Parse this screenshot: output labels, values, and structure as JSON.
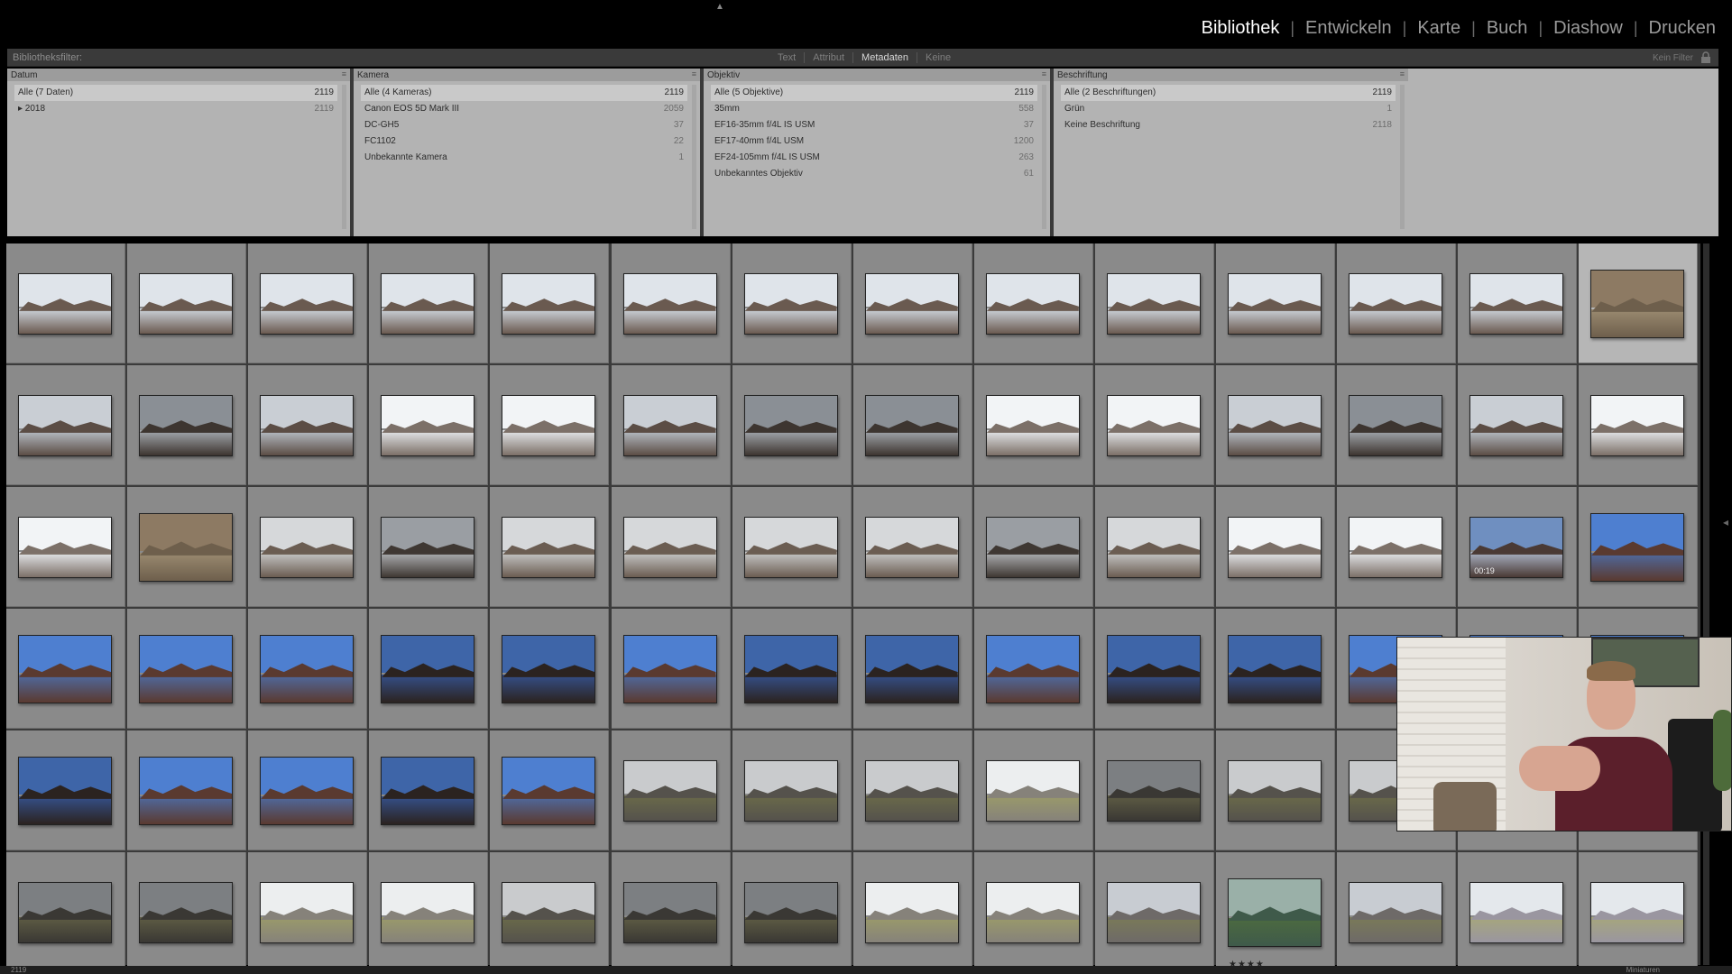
{
  "modules": [
    "Bibliothek",
    "Entwickeln",
    "Karte",
    "Buch",
    "Diashow",
    "Drucken"
  ],
  "active_module": 0,
  "filter_bar": {
    "title": "Bibliotheksfilter:",
    "tabs": [
      "Text",
      "Attribut",
      "Metadaten",
      "Keine"
    ],
    "active_tab": 2,
    "right_label": "Kein Filter"
  },
  "columns": [
    {
      "header": "Datum",
      "rows": [
        {
          "label": "Alle (7 Daten)",
          "count": "2119",
          "selected": true
        },
        {
          "label": "▸ 2018",
          "count": "2119",
          "selected": false
        }
      ]
    },
    {
      "header": "Kamera",
      "rows": [
        {
          "label": "Alle (4 Kameras)",
          "count": "2119",
          "selected": true
        },
        {
          "label": "Canon EOS 5D Mark III",
          "count": "2059",
          "selected": false
        },
        {
          "label": "DC-GH5",
          "count": "37",
          "selected": false
        },
        {
          "label": "FC1102",
          "count": "22",
          "selected": false
        },
        {
          "label": "Unbekannte Kamera",
          "count": "1",
          "selected": false
        }
      ]
    },
    {
      "header": "Objektiv",
      "rows": [
        {
          "label": "Alle (5 Objektive)",
          "count": "2119",
          "selected": true
        },
        {
          "label": "35mm",
          "count": "558",
          "selected": false
        },
        {
          "label": "EF16-35mm f/4L IS USM",
          "count": "37",
          "selected": false
        },
        {
          "label": "EF17-40mm f/4L USM",
          "count": "1200",
          "selected": false
        },
        {
          "label": "EF24-105mm f/4L IS USM",
          "count": "263",
          "selected": false
        },
        {
          "label": "Unbekanntes Objektiv",
          "count": "61",
          "selected": false
        }
      ]
    },
    {
      "header": "Beschriftung",
      "rows": [
        {
          "label": "Alle (2 Beschriftungen)",
          "count": "2119",
          "selected": true
        },
        {
          "label": "Grün",
          "count": "1",
          "selected": false
        },
        {
          "label": "Keine Beschriftung",
          "count": "2118",
          "selected": false
        }
      ]
    }
  ],
  "thumbnail_rows": [
    [
      "lake",
      "lake",
      "lake",
      "lake",
      "lake",
      "lake",
      "lake",
      "lake",
      "lake",
      "lake",
      "lake",
      "lake",
      "lake",
      "aerial"
    ],
    [
      "cloud",
      "dark",
      "cloud",
      "bright",
      "bright",
      "cloud",
      "dark",
      "dark",
      "bright",
      "bright",
      "cloud",
      "dark",
      "cloud",
      "bright"
    ],
    [
      "bright",
      "aerial",
      "castle",
      "castledark",
      "castle",
      "castle",
      "castle",
      "castle",
      "castledark",
      "castle",
      "bright",
      "bright",
      "video",
      "blue"
    ],
    [
      "blue",
      "blue",
      "blue",
      "bluedark",
      "bluedark",
      "blue",
      "bluedark",
      "bluedark",
      "blue",
      "bluedark",
      "bluedark",
      "blue",
      "blue",
      "blue"
    ],
    [
      "bluedark",
      "blue",
      "blue",
      "bluedark",
      "blue",
      "field",
      "field",
      "field",
      "fieldbright",
      "fielddark",
      "field",
      "field",
      "field",
      "field"
    ],
    [
      "fielddark",
      "fielddark",
      "fieldbright",
      "fieldbright",
      "field",
      "fielddark",
      "fielddark",
      "fieldbright",
      "fieldbright",
      "cows",
      "cowsgreen",
      "cows",
      "cowsbright",
      "cowsbright"
    ]
  ],
  "selected_thumb": {
    "row": 0,
    "col": 13
  },
  "video_duration": "00:19",
  "video_cell": {
    "row": 2,
    "col": 12
  },
  "stars_cell": {
    "row": 5,
    "col": 10
  },
  "stars": "★★★★",
  "palettes": {
    "lake": [
      "#dfe4ea",
      "#6a5a50",
      "#cfd6de"
    ],
    "aerial": [
      "#8d7a63",
      "#6e5f4c",
      "#9a8a70"
    ],
    "cloud": [
      "#c9ced4",
      "#5b4d45",
      "#b9c0c8"
    ],
    "dark": [
      "#8a8f95",
      "#3d3530",
      "#a5aab0"
    ],
    "bright": [
      "#f2f4f6",
      "#7c7068",
      "#e6e9ec"
    ],
    "castle": [
      "#d6d8da",
      "#6b5d52",
      "#c8c9c9"
    ],
    "castledark": [
      "#9a9ea3",
      "#3f3833",
      "#b0b3b6"
    ],
    "video": [
      "#6f8fc0",
      "#4a3a35",
      "#aab4c6"
    ],
    "blue": [
      "#4e7fd0",
      "#5a3a30",
      "#4f6aa0"
    ],
    "bluedark": [
      "#3e65a8",
      "#2b2320",
      "#35508a"
    ],
    "field": [
      "#c9cbcd",
      "#55524c",
      "#6a6a4a"
    ],
    "fielddark": [
      "#7c7f82",
      "#3a3834",
      "#5e5c44"
    ],
    "fieldbright": [
      "#eceeef",
      "#86827a",
      "#9a9a6a"
    ],
    "cows": [
      "#c8ccd2",
      "#6e6a68",
      "#7a7a58"
    ],
    "cowsgreen": [
      "#9ab0a8",
      "#3f5a4a",
      "#4c6a40"
    ],
    "cowsbright": [
      "#e4e8ec",
      "#9a96a0",
      "#a6a67c"
    ]
  },
  "bottom_left": "2119",
  "bottom_right": "Miniaturen"
}
